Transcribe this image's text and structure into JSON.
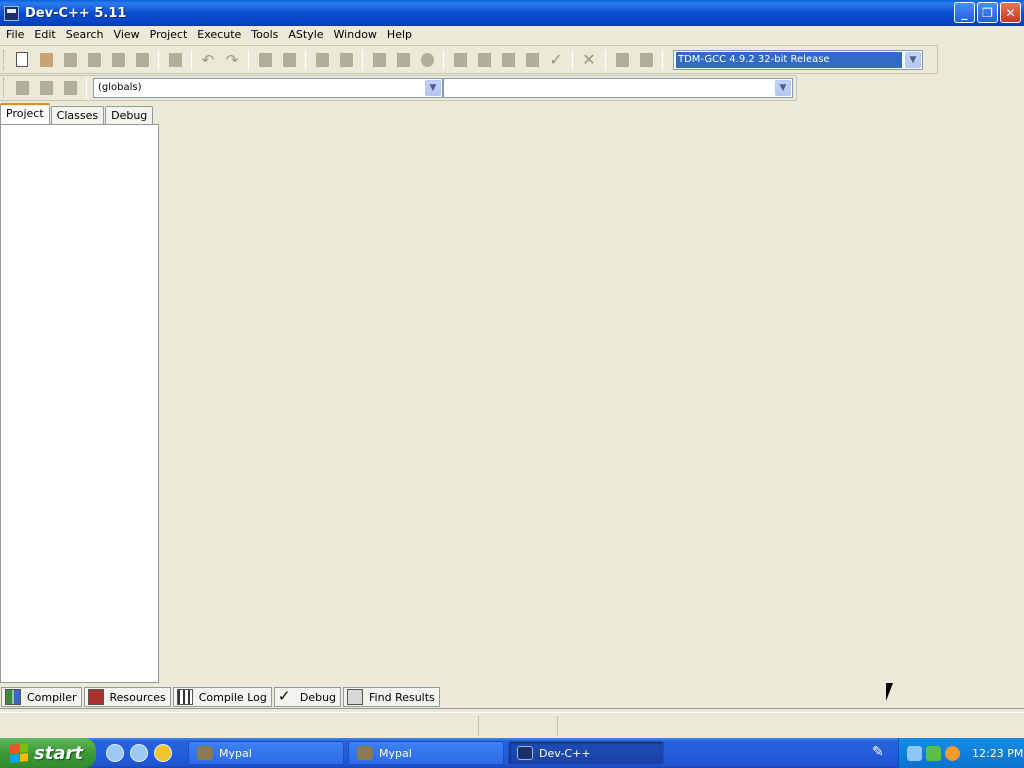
{
  "window": {
    "title": "Dev-C++ 5.11",
    "icon": "devcpp-app-icon",
    "controls": [
      "minimize-icon",
      "restore-icon",
      "close-icon"
    ]
  },
  "menu": [
    "File",
    "Edit",
    "Search",
    "View",
    "Project",
    "Execute",
    "Tools",
    "AStyle",
    "Window",
    "Help"
  ],
  "toolbar": {
    "compiler_select": "TDM-GCC 4.9.2 32-bit Release",
    "scope_select": "(globals)",
    "symbol_select": ""
  },
  "left_tabs": [
    "Project",
    "Classes",
    "Debug"
  ],
  "bottom_tabs": [
    {
      "label": "Compiler",
      "icon": "compiler-grid-icon"
    },
    {
      "label": "Resources",
      "icon": "resources-icon"
    },
    {
      "label": "Compile Log",
      "icon": "chart-icon"
    },
    {
      "label": "Debug",
      "icon": "checkmark-icon"
    },
    {
      "label": "Find Results",
      "icon": "find-icon"
    }
  ],
  "taskbar": {
    "start_label": "start",
    "tasks": [
      "Mypal",
      "Mypal",
      "Dev-C++"
    ],
    "clock": "12:23 PM"
  }
}
